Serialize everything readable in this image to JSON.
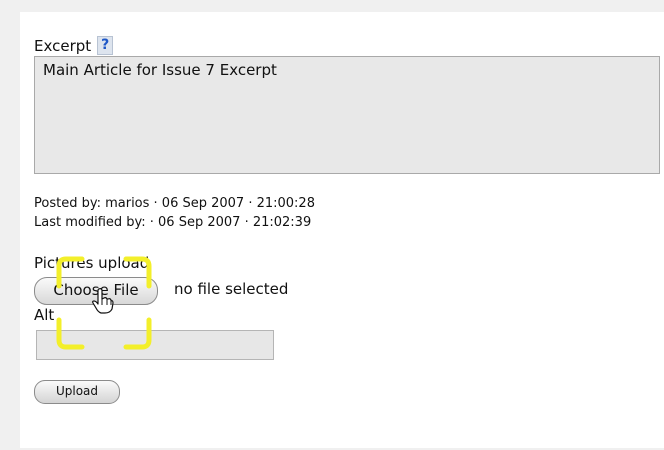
{
  "excerpt": {
    "label": "Excerpt",
    "help": "?",
    "text": "Main Article for Issue 7 Excerpt"
  },
  "meta": {
    "posted_by": "Posted by: marios · 06 Sep 2007 · 21:00:28",
    "last_modified_by": "Last modified by: · 06 Sep 2007 · 21:02:39"
  },
  "uploader": {
    "label": "Pictures upload",
    "choose_button": "Choose File",
    "file_status": "no file selected",
    "alt_label": "Alt",
    "alt_value": "",
    "upload_button": "Upload"
  },
  "colors": {
    "help_text": "#1e57c7",
    "highlight": "#f3ef2a"
  }
}
